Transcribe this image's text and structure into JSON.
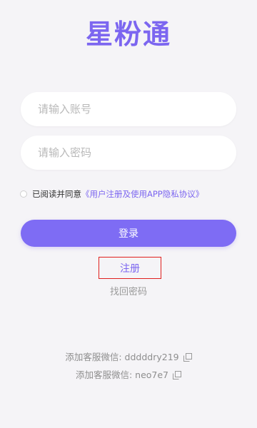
{
  "app": {
    "logo_text": "星粉通"
  },
  "login_form": {
    "account_placeholder": "请输入账号",
    "account_value": "",
    "password_placeholder": "请输入密码",
    "password_value": "",
    "agree_prefix": "已阅读并同意",
    "agreement_link": "《用户注册及使用APP隐私协议》",
    "agree_checked": false,
    "login_label": "登录",
    "register_label": "注册",
    "forgot_label": "找回密码"
  },
  "support": {
    "wechat_label_1": "添加客服微信: dddddry219",
    "wechat_label_2": "添加客服微信: neo7e7",
    "copy_icon": "copy-icon"
  },
  "colors": {
    "accent": "#7c66f0",
    "button": "#7e6cf4",
    "background": "#f5f4f7",
    "highlight_border": "#e0201e",
    "muted_text": "#9a9a9a"
  }
}
